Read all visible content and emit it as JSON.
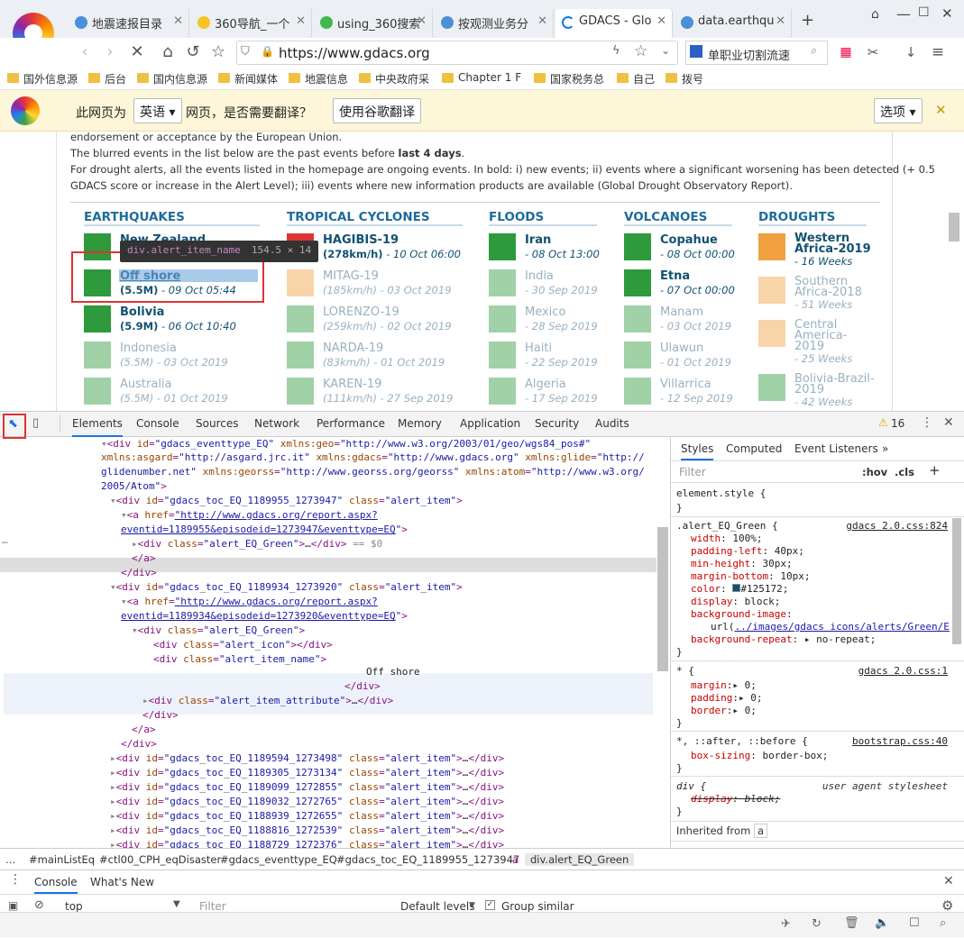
{
  "tabs": [
    {
      "label": "地震速报目录"
    },
    {
      "label": "360导航_一个"
    },
    {
      "label": "using_360搜索"
    },
    {
      "label": "按观测业务分"
    },
    {
      "label": "GDACS - Glo"
    },
    {
      "label": "data.earthqu"
    }
  ],
  "address": {
    "url": "https://www.gdacs.org",
    "search_text": "单职业切割流速"
  },
  "bookmarks": [
    "国外信息源",
    "后台",
    "国内信息源",
    "新闻媒体",
    "地震信息",
    "中央政府采",
    "Chapter 1 F",
    "国家税务总",
    "自己",
    "拨号"
  ],
  "translate": {
    "prefix": "此网页为",
    "language": "英语",
    "suffix": "网页，是否需要翻译？",
    "translate_button": "使用谷歌翻译",
    "options_button": "选项"
  },
  "page": {
    "para1": "endorsement or acceptance by the European Union.",
    "para2_a": "The blurred events in the list below are the past events before ",
    "para2_b": "last 4 days",
    "para2_c": ".",
    "para3": "For drought alerts, all the events listed in the homepage are ongoing events. In bold: i) new events; ii) events where a significant worsening has been detected (+ 0.5",
    "para4": "GDACS score or increase in the Alert Level); iii) events where new information products are available (Global Drought Observatory Report).",
    "columns": [
      {
        "title": "EARTHQUAKES",
        "items": [
          {
            "name": "New Zealand",
            "mag": "",
            "date": ""
          },
          {
            "name": "Off shore",
            "mag": "(5.5M)",
            "date": " - 09 Oct  05:44"
          },
          {
            "name": "Bolivia",
            "mag": "(5.9M)",
            "date": " - 06 Oct  10:40"
          },
          {
            "name": "Indonesia",
            "mag": "(5.5M)",
            "date": " - 03 Oct 2019"
          },
          {
            "name": "Australia",
            "mag": "(5.5M)",
            "date": " - 01 Oct 2019"
          }
        ]
      },
      {
        "title": "TROPICAL CYCLONES",
        "items": [
          {
            "name": "HAGIBIS-19",
            "mag": "(278km/h)",
            "date": " - 10 Oct  06:00"
          },
          {
            "name": "MITAG-19",
            "mag": "(185km/h)",
            "date": " - 03 Oct 2019"
          },
          {
            "name": "LORENZO-19",
            "mag": "(259km/h)",
            "date": " - 02 Oct 2019"
          },
          {
            "name": "NARDA-19",
            "mag": "(83km/h)",
            "date": " - 01 Oct 2019"
          },
          {
            "name": "KAREN-19",
            "mag": "(111km/h)",
            "date": " - 27 Sep 2019"
          }
        ]
      },
      {
        "title": "FLOODS",
        "items": [
          {
            "name": "Iran",
            "mag": "",
            "date": " - 08 Oct  13:00"
          },
          {
            "name": "India",
            "mag": "",
            "date": " - 30 Sep 2019"
          },
          {
            "name": "Mexico",
            "mag": "",
            "date": " - 28 Sep 2019"
          },
          {
            "name": "Haiti",
            "mag": "",
            "date": " - 22 Sep 2019"
          },
          {
            "name": "Algeria",
            "mag": "",
            "date": " - 17 Sep 2019"
          }
        ]
      },
      {
        "title": "VOLCANOES",
        "items": [
          {
            "name": "Copahue",
            "mag": "",
            "date": " - 08 Oct  00:00"
          },
          {
            "name": "Etna",
            "mag": "",
            "date": " - 07 Oct  00:00"
          },
          {
            "name": "Manam",
            "mag": "",
            "date": " - 03 Oct 2019"
          },
          {
            "name": "Ulawun",
            "mag": "",
            "date": " - 01 Oct 2019"
          },
          {
            "name": "Villarrica",
            "mag": "",
            "date": " - 12 Sep 2019"
          }
        ]
      },
      {
        "title": "DROUGHTS",
        "items": [
          {
            "name": "Western Africa-2019",
            "mag": "",
            "date": " - 16 Weeks"
          },
          {
            "name": "Southern Africa-2018",
            "mag": "",
            "date": " - 51 Weeks"
          },
          {
            "name": "Central America-2019",
            "mag": "",
            "date": " - 25 Weeks"
          },
          {
            "name": "Bolivia-Brazil-2019",
            "mag": "",
            "date": " - 42 Weeks"
          }
        ]
      }
    ],
    "tooltip": "div.alert_item_name",
    "tooltip_size": "154.5 × 14"
  },
  "devtools": {
    "tabs": [
      "Elements",
      "Console",
      "Sources",
      "Network",
      "Performance",
      "Memory",
      "Application",
      "Security",
      "Audits"
    ],
    "warning_count": "16",
    "styles_tabs": [
      "Styles",
      "Computed",
      "Event Listeners"
    ],
    "filter_placeholder": "Filter",
    "hov": ":hov",
    "cls": ".cls",
    "breadcrumb": [
      "#mainListEq",
      "#ctl00_CPH_eqDisaster",
      "#gdacs_eventtype_EQ",
      "#gdacs_toc_EQ_1189955_1273947",
      "a",
      "div.alert_EQ_Green"
    ],
    "drawer_tabs": [
      "Console",
      "What's New"
    ],
    "console_context": "top",
    "console_filter": "Filter",
    "default_levels": "Default levels",
    "group_similar": "Group similar"
  }
}
